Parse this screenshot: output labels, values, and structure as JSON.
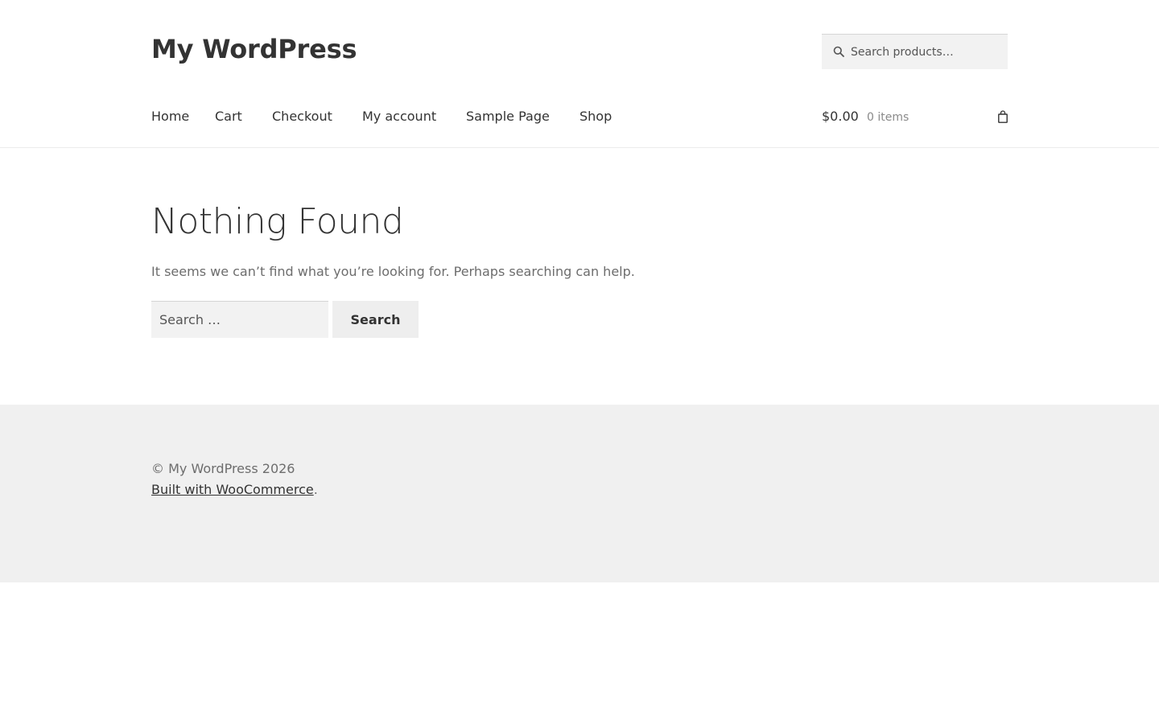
{
  "header": {
    "site_title": "My WordPress",
    "product_search": {
      "placeholder": "Search products…",
      "icon": "search-icon"
    },
    "nav": [
      {
        "label": "Home"
      },
      {
        "label": "Cart"
      },
      {
        "label": "Checkout"
      },
      {
        "label": "My account"
      },
      {
        "label": "Sample Page"
      },
      {
        "label": "Shop"
      }
    ],
    "cart": {
      "amount": "$0.00",
      "count": "0 items",
      "icon": "shopping-bag-icon"
    }
  },
  "main": {
    "title": "Nothing Found",
    "message": "It seems we can’t find what you’re looking for. Perhaps searching can help.",
    "search": {
      "placeholder": "Search …",
      "value": "",
      "button_label": "Search"
    }
  },
  "footer": {
    "copyright": "© My WordPress 2026",
    "credit_link": "Built with WooCommerce",
    "credit_suffix": "."
  },
  "colors": {
    "text": "#333333",
    "muted_text": "#6d6d6d",
    "footer_bg": "#f0f0f0",
    "input_bg": "#f2f2f2"
  }
}
